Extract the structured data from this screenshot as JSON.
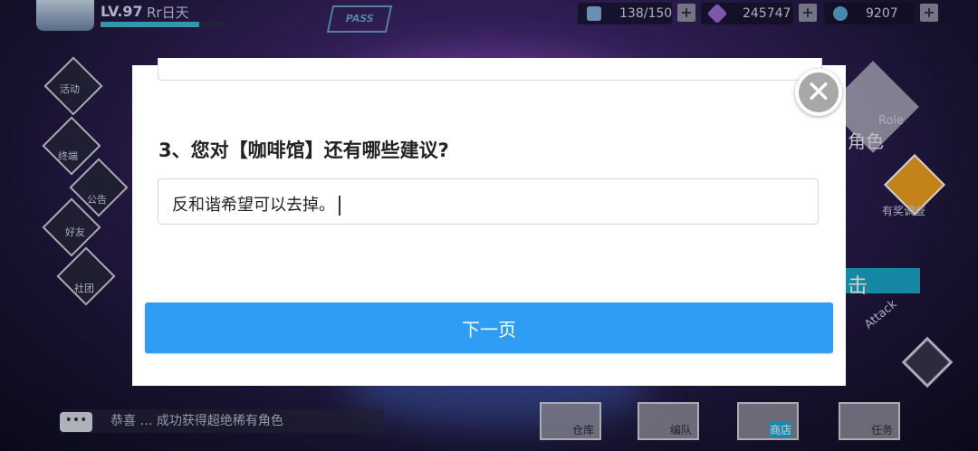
{
  "hud": {
    "level": "LV.97",
    "player_name": "Rr日天",
    "xp_progress": 0.8,
    "pass_label": "PASS",
    "stamina": "138/150",
    "gems": "245747",
    "coins": "9207",
    "plus": "+"
  },
  "side_menu": {
    "activity": "活动",
    "terminal": "终端",
    "notice": "公告",
    "friends": "好友",
    "guild": "社团"
  },
  "right_menu": {
    "role": "Role",
    "role_cn": "角色",
    "survey": "有奖调查",
    "attack_cn": "击",
    "attack": "Attack"
  },
  "bottom_bar": {
    "message": "恭喜 … 成功获得超绝稀有角色",
    "warehouse": "仓库",
    "team": "编队",
    "shop": "商店",
    "tasks": "任务"
  },
  "modal": {
    "question": "3、您对【咖啡馆】还有哪些建议?",
    "answer_value": "反和谐希望可以去掉。",
    "next_label": "下一页",
    "close_symbol": "✕"
  },
  "colors": {
    "button_blue": "#2f9df4",
    "close_gray": "#a8a8a8"
  }
}
